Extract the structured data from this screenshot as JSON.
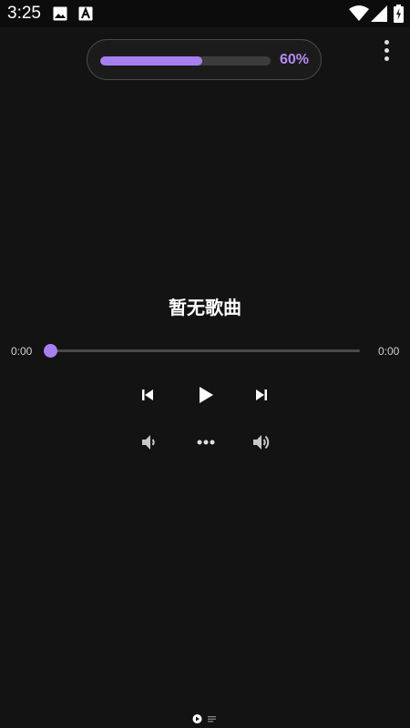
{
  "status_bar": {
    "time": "3:25",
    "icons": [
      "image-icon",
      "a-notification-icon",
      "wifi-icon",
      "signal-icon",
      "battery-charging-icon"
    ]
  },
  "volume": {
    "level": 0.6,
    "percent_label": "60%",
    "accent": "#a87ff0"
  },
  "menu": {
    "icon": "more-vert-icon"
  },
  "song": {
    "title": "暂无歌曲"
  },
  "seek": {
    "elapsed": "0:00",
    "duration": "0:00",
    "position": 0
  },
  "controls": {
    "previous": "skip-previous-icon",
    "play": "play-icon",
    "next": "skip-next-icon",
    "volume_down": "volume-down-icon",
    "more": "more-horiz-icon",
    "volume_up": "volume-up-icon"
  },
  "bottom_indicator": {
    "icons": [
      "play-circle-icon",
      "playlist-icon"
    ]
  },
  "colors": {
    "background": "#131313",
    "accent": "#a87ff0",
    "text": "#ffffff"
  }
}
